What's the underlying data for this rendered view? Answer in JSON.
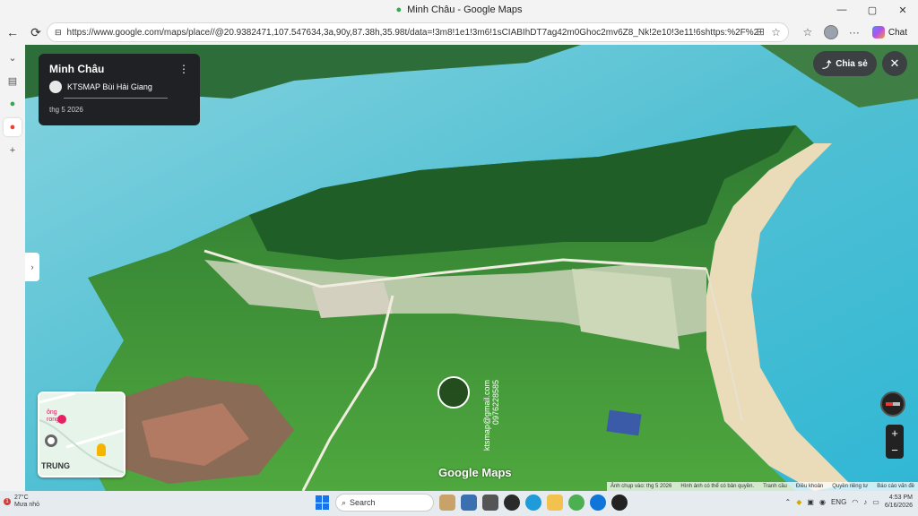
{
  "window": {
    "title": "Minh Châu - Google Maps"
  },
  "browser": {
    "url": "https://www.google.com/maps/place//@20.9382471,107.547634,3a,90y,87.38h,35.98t/data=!3m8!1e1!3m6!1sCIABIhDT7ag42m0Ghoc2mv6Z8_Nk!2e10!3e11!6shttps:%2F%2Flh3.go...",
    "chat_label": "Chat"
  },
  "panel": {
    "place_name": "Minh Châu",
    "author": "KTSMAP Bùi Hải Giang",
    "date": "thg 5 2026"
  },
  "controls": {
    "share_label": "Chia sẻ",
    "zoom_in": "+",
    "zoom_out": "−"
  },
  "minimap": {
    "label_pink": "ông\nrong",
    "label_bottom": "TRUNG"
  },
  "watermark": {
    "email": "ktsmap@gmail.com",
    "phone": "0976228585",
    "brand": "Google Maps"
  },
  "attribution": {
    "capture": "Ảnh chụp vào: thg 5 2026",
    "copyright": "Hình ảnh có thể có bản quyền.",
    "terms": "Tranh cầu",
    "privacy": "Điều khoản",
    "rights": "Quyền riêng tư",
    "report": "Báo cáo vấn đề"
  },
  "taskbar": {
    "temp": "27°C",
    "weather": "Mưa nhỏ",
    "badge": "1",
    "search_placeholder": "Search",
    "lang": "ENG",
    "time": "4:53 PM",
    "date": "6/16/2026"
  },
  "colors": {
    "sea": "#5cc6d6",
    "card": "#202124",
    "accent": "#1a73e8"
  }
}
